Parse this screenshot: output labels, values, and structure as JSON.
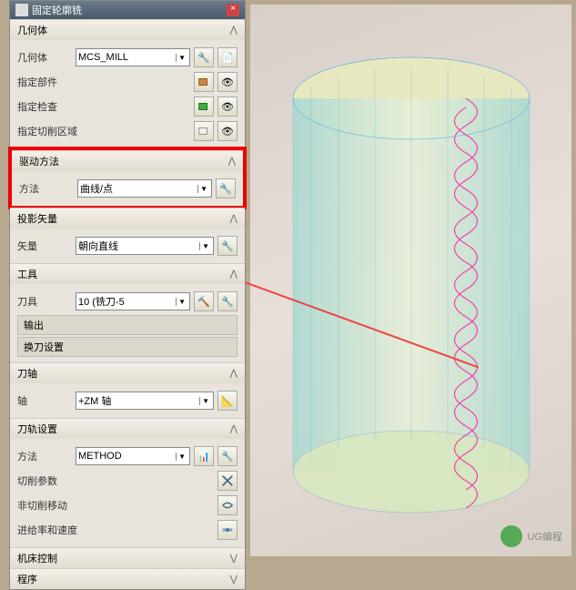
{
  "title": "固定轮廓铣",
  "sections": {
    "geom": {
      "header": "几何体",
      "body_label": "几何体",
      "body_value": "MCS_MILL",
      "part_label": "指定部件",
      "check_label": "指定检查",
      "cutarea_label": "指定切削区域"
    },
    "drive": {
      "header": "驱动方法",
      "method_label": "方法",
      "method_value": "曲线/点"
    },
    "proj": {
      "header": "投影矢量",
      "vec_label": "矢量",
      "vec_value": "朝向直线"
    },
    "tool": {
      "header": "工具",
      "tool_label": "刀具",
      "tool_value": "10 (铣刀-5",
      "output_label": "输出",
      "change_label": "换刀设置"
    },
    "axis": {
      "header": "刀轴",
      "axis_label": "轴",
      "axis_value": "+ZM 轴"
    },
    "path": {
      "header": "刀轨设置",
      "method_label": "方法",
      "method_value": "METHOD",
      "cut_label": "切削参数",
      "noncut_label": "非切削移动",
      "feed_label": "进给率和速度"
    },
    "machine": {
      "header": "机床控制"
    },
    "program": {
      "header": "程序"
    }
  },
  "watermark": "UG编程"
}
